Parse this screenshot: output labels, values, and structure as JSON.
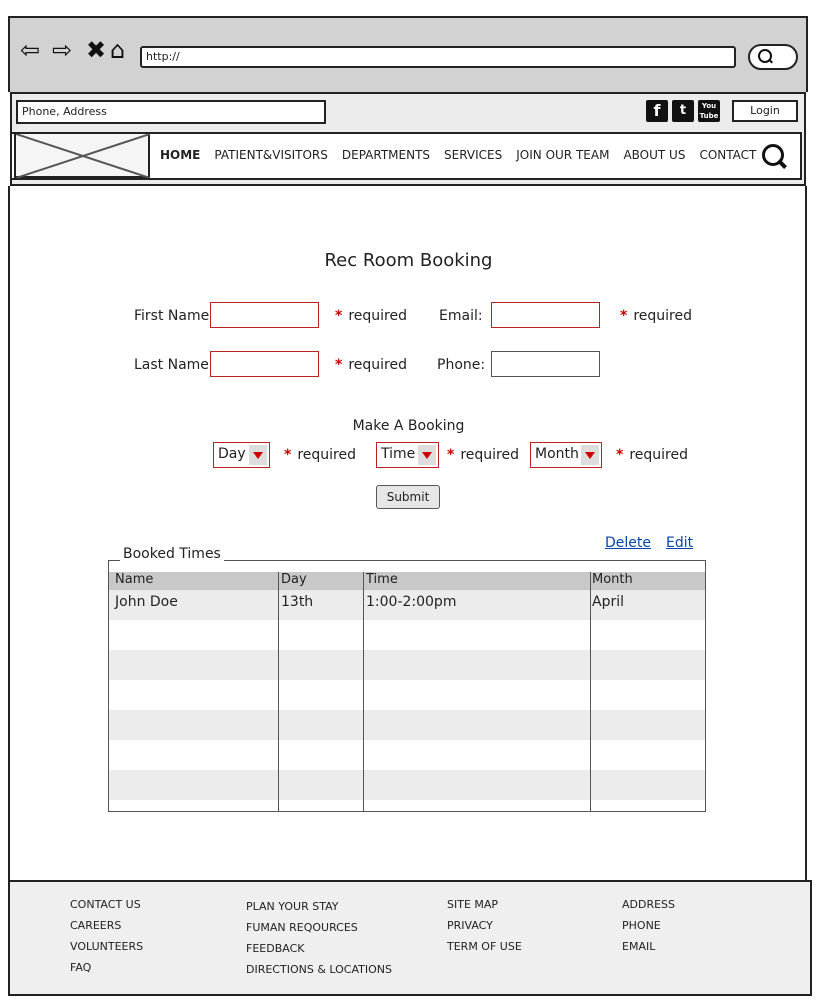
{
  "browser": {
    "url": "http://"
  },
  "header": {
    "address_placeholder": "Phone, Address",
    "social": [
      "f",
      "t",
      "You Tube"
    ],
    "login_label": "Login"
  },
  "nav": {
    "items": [
      "HOME",
      "PATIENT&VISITORS",
      "DEPARTMENTS",
      "SERVICES",
      "JOIN OUR TEAM",
      "ABOUT US",
      "CONTACT"
    ]
  },
  "form": {
    "title": "Rec Room Booking",
    "first_name_label": "First Name:",
    "last_name_label": "Last Name",
    "email_label": "Email:",
    "phone_label": "Phone:",
    "required_text": "required",
    "required_star": "*",
    "booking_heading": "Make A Booking",
    "day_value": "Day",
    "time_value": "Time",
    "month_value": "Month",
    "submit_label": "Submit"
  },
  "table": {
    "legend": "Booked Times",
    "delete_label": "Delete",
    "edit_label": "Edit",
    "columns": [
      "Name",
      "Day",
      "Time",
      "Month"
    ],
    "rows": [
      [
        "John Doe",
        "13th",
        "1:00-2:00pm",
        "April"
      ]
    ]
  },
  "footer": {
    "col1": [
      "CONTACT US",
      "CAREERS",
      "VOLUNTEERS",
      "FAQ"
    ],
    "col2": [
      "PLAN YOUR STAY",
      "FUMAN REQOURCES",
      "FEEDBACK",
      "DIRECTIONS & LOCATIONS"
    ],
    "col3": [
      "SITE MAP",
      "PRIVACY",
      "TERM OF USE"
    ],
    "col4": [
      "ADDRESS",
      "PHONE",
      "EMAIL"
    ]
  }
}
